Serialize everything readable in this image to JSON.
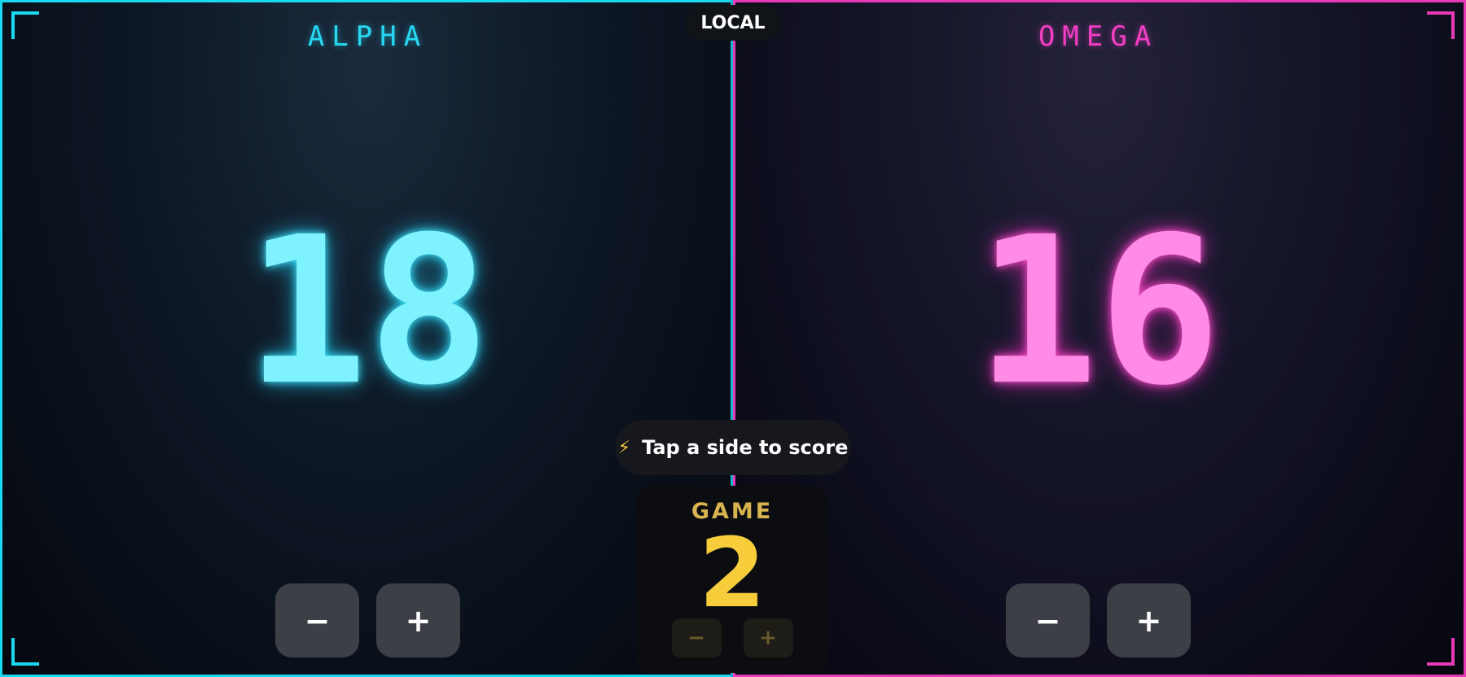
{
  "mode": {
    "label": "LOCAL"
  },
  "hint": {
    "icon": "lightning-icon",
    "glyph": "⚡",
    "text": "Tap a side to score"
  },
  "teams": {
    "left": {
      "name": "ALPHA",
      "score": "18",
      "minus": "−",
      "plus": "+",
      "color": "#27d8f2"
    },
    "right": {
      "name": "OMEGA",
      "score": "16",
      "minus": "−",
      "plus": "+",
      "color": "#f33fc4"
    }
  },
  "game": {
    "label": "GAME",
    "number": "2",
    "minus": "−",
    "plus": "+",
    "color": "#f8cd3c"
  }
}
